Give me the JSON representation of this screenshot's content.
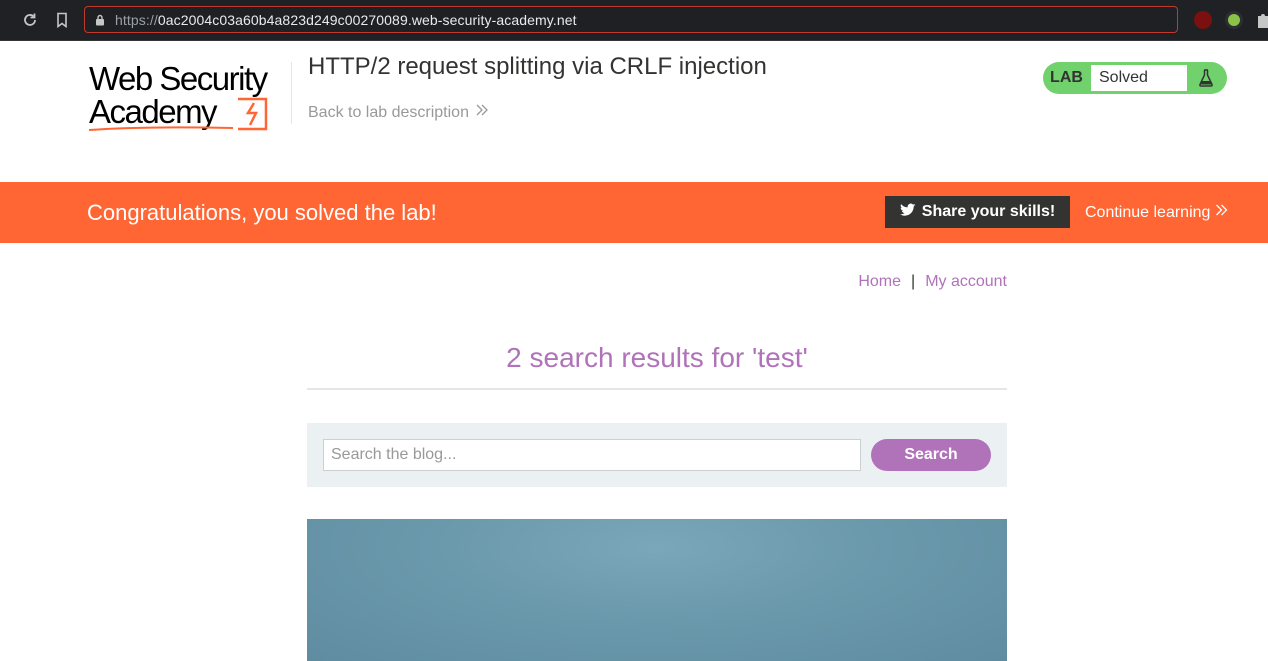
{
  "browser": {
    "url_protocol": "https://",
    "url_host": "0ac2004c03a60b4a823d249c00270089.web-security-academy.net"
  },
  "header": {
    "lab_title": "HTTP/2 request splitting via CRLF injection",
    "back_link": "Back to lab description",
    "lab_label": "LAB",
    "lab_status": "Solved"
  },
  "banner": {
    "message": "Congratulations, you solved the lab!",
    "share_label": "Share your skills!",
    "continue_label": "Continue learning"
  },
  "nav": {
    "home": "Home",
    "separator": "|",
    "account": "My account"
  },
  "search": {
    "heading": "2 search results for 'test'",
    "placeholder": "Search the blog...",
    "button": "Search"
  },
  "colors": {
    "accent": "#b073b9",
    "banner": "#ff6633",
    "solved": "#70d16d"
  }
}
